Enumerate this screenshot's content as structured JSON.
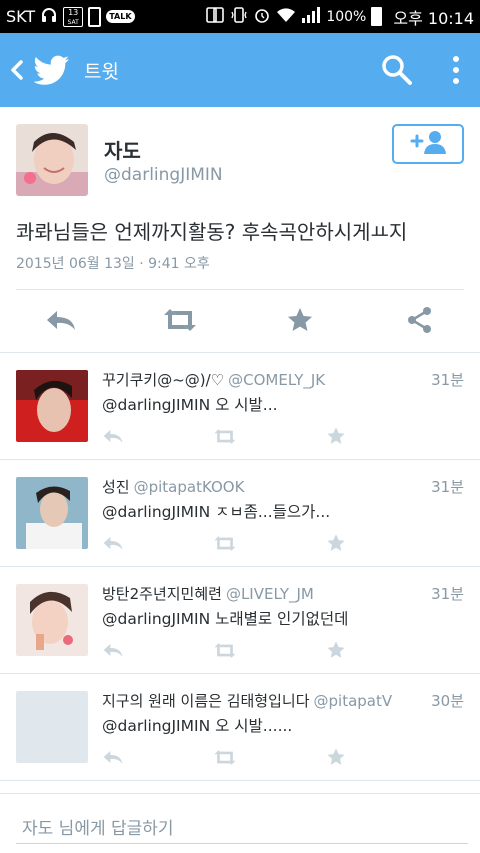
{
  "statusbar": {
    "carrier": "SKT",
    "date_icon_text": "13",
    "date_icon_sub": "SAT",
    "talk": "TALK",
    "battery": "100%",
    "time": "오후 10:14"
  },
  "appbar": {
    "title": "트윗",
    "color": "#55acee"
  },
  "main_tweet": {
    "name": "자도",
    "handle": "@darlingJIMIN",
    "text": "콰롸님들은 언제까지활동? 후속곡안하시게ㅛ지",
    "timestamp": "2015년 06월 13일 · 9:41 오후"
  },
  "replies": [
    {
      "name": "꾸기쿠키@~@)/♡",
      "handle": "@COMELY_JK",
      "ago": "31분",
      "text": "@darlingJIMIN 오 시발..."
    },
    {
      "name": "성진",
      "handle": "@pitapatKOOK",
      "ago": "31분",
      "text": "@darlingJIMIN ㅈㅂ좀...들으가..."
    },
    {
      "name": "방탄2주년지민혜련",
      "handle": "@LIVELY_JM",
      "ago": "31분",
      "text": "@darlingJIMIN 노래별로 인기없던데"
    },
    {
      "name": "지구의 원래 이름은 김태형입니다",
      "handle": "@pitapatV",
      "ago": "30분",
      "text": "@darlingJIMIN 오 시발......"
    }
  ],
  "compose": {
    "placeholder": "자도 님에게 답글하기"
  },
  "icons": {
    "back": "chevron-left-icon",
    "logo": "twitter-bird-icon",
    "search": "search-icon",
    "more": "overflow-menu-icon",
    "follow": "follow-user-icon",
    "reply": "reply-icon",
    "retweet": "retweet-icon",
    "favorite": "star-icon",
    "share": "share-icon"
  }
}
